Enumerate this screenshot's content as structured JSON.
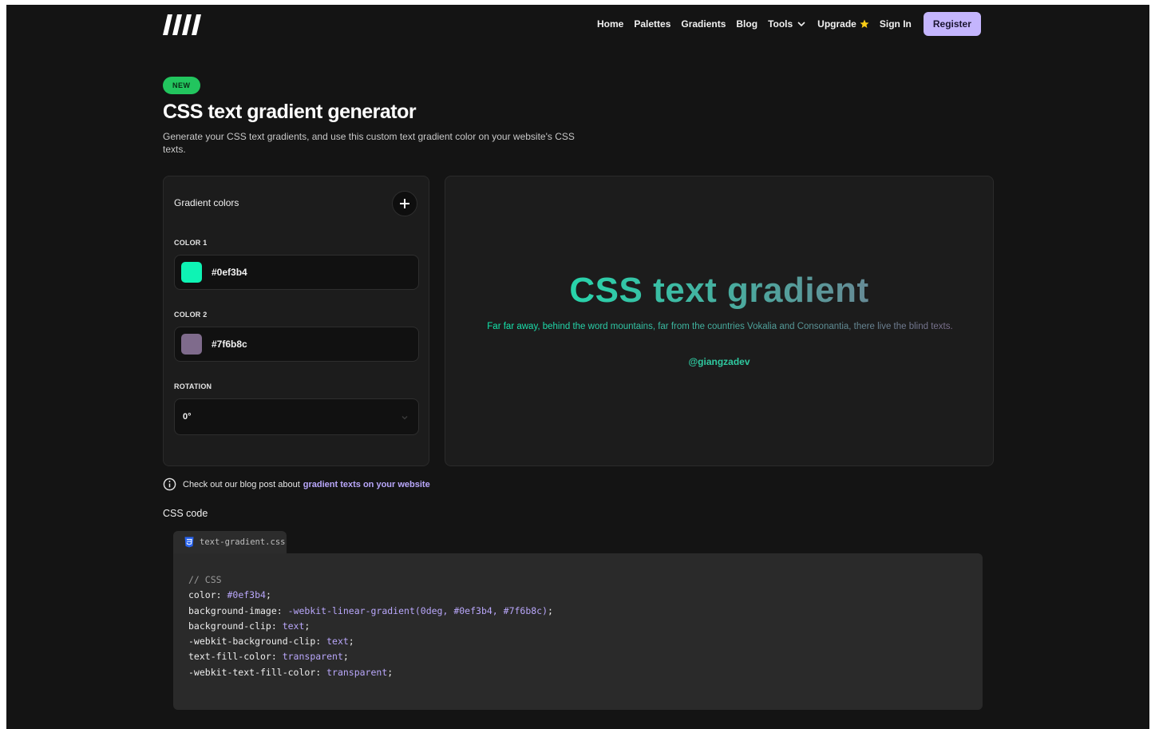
{
  "nav": {
    "items": [
      {
        "label": "Home"
      },
      {
        "label": "Palettes"
      },
      {
        "label": "Gradients"
      },
      {
        "label": "Blog"
      },
      {
        "label": "Tools"
      },
      {
        "label": "Upgrade"
      },
      {
        "label": "Sign In"
      }
    ],
    "register_label": "Register"
  },
  "header": {
    "badge": "NEW",
    "title": "CSS text gradient generator",
    "description": "Generate your CSS text gradients, and use this custom text gradient color on your website's CSS texts."
  },
  "panel": {
    "title": "Gradient colors",
    "color1": {
      "label": "COLOR 1",
      "value": "#0ef3b4",
      "swatch": "#0ef3b4"
    },
    "color2": {
      "label": "COLOR 2",
      "value": "#7f6b8c",
      "swatch": "#7f6b8c"
    },
    "rotation": {
      "label": "ROTATION",
      "value": "0°"
    }
  },
  "preview": {
    "title": "CSS text gradient",
    "text": "Far far away, behind the word mountains, far from the countries Vokalia and Consonantia, there live the blind texts.",
    "handle": "@giangzadev"
  },
  "info": {
    "text": "Check out our blog post about",
    "link": "gradient texts on your website"
  },
  "code": {
    "label": "CSS code",
    "filename": "text-gradient.css",
    "comment": "// CSS",
    "lines": [
      {
        "prop": "color: ",
        "val": "#0ef3b4",
        "end": ";"
      },
      {
        "prop": "background-image: ",
        "val": "-webkit-linear-gradient(0deg, #0ef3b4, #7f6b8c)",
        "end": ";"
      },
      {
        "prop": "background-clip: ",
        "val": "text",
        "end": ";"
      },
      {
        "prop": "-webkit-background-clip: ",
        "val": "text",
        "end": ";"
      },
      {
        "prop": "text-fill-color: ",
        "val": "transparent",
        "end": ";"
      },
      {
        "prop": "-webkit-text-fill-color: ",
        "val": "transparent",
        "end": ";"
      }
    ]
  },
  "colors": {
    "accent": "#c4b5fd",
    "badge": "#22c55e",
    "gradient_start": "#0ef3b4",
    "gradient_end": "#7f6b8c"
  },
  "icons": [
    "logo-icon",
    "chevron-down-icon",
    "star-icon",
    "plus-icon",
    "info-icon",
    "css-file-icon"
  ]
}
